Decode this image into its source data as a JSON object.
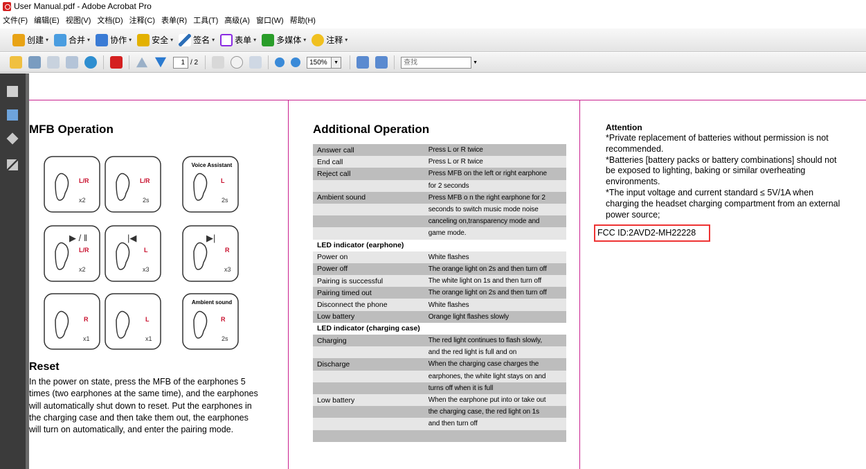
{
  "window": {
    "title": "User Manual.pdf - Adobe Acrobat Pro"
  },
  "menu": [
    "文件(F)",
    "编辑(E)",
    "视图(V)",
    "文档(D)",
    "注释(C)",
    "表单(R)",
    "工具(T)",
    "高级(A)",
    "窗口(W)",
    "帮助(H)"
  ],
  "toolbar1": [
    {
      "label": "创建",
      "icon": "create-icon",
      "color": "#e8a316"
    },
    {
      "label": "合并",
      "icon": "combine-icon",
      "color": "#4a9de0"
    },
    {
      "label": "协作",
      "icon": "collaborate-icon",
      "color": "#3a7bd5"
    },
    {
      "label": "安全",
      "icon": "lock-icon",
      "color": "#e3b100"
    },
    {
      "label": "签名",
      "icon": "pen-icon",
      "color": "#2d6fb8"
    },
    {
      "label": "表单",
      "icon": "form-icon",
      "color": "#8a2be2"
    },
    {
      "label": "多媒体",
      "icon": "multimedia-icon",
      "color": "#2a9d2a"
    },
    {
      "label": "注释",
      "icon": "comment-icon",
      "color": "#f0c020"
    }
  ],
  "toolbar2": {
    "page_current": "1",
    "page_total": "/ 2",
    "zoom": "150%",
    "find_placeholder": "查找"
  },
  "doc": {
    "mfb_heading": "MFB Operation",
    "voice_assistant": "Voice Assistant",
    "ambient_sound": "Ambient sound",
    "reset_heading": "Reset",
    "reset_lines": [
      "In the power on state, press the MFB of the earphones 5",
      "times (two earphones at the same time), and the earphones",
      "will automatically shut down to reset. Put the earphones in",
      "the charging case and then take them out, the earphones",
      "will turn on automatically, and enter the pairing mode."
    ],
    "additional_heading": "Additional Operation",
    "table": [
      {
        "c1": "Answer call",
        "c2": "Press L or R twice",
        "style": "dark"
      },
      {
        "c1": "End call",
        "c2": "Press L or R twice",
        "style": "light"
      },
      {
        "c1": "Reject call",
        "c2": "Press  MFB  on the left or right earphone",
        "style": "dark"
      },
      {
        "c1": "",
        "c2": "for 2 seconds",
        "style": "light"
      },
      {
        "c1": "Ambient sound",
        "c2": "Press MFB o n the right earphone for 2",
        "style": "dark"
      },
      {
        "c1": "",
        "c2": "seconds to switch music mode noise",
        "style": "light"
      },
      {
        "c1": "",
        "c2": "canceling on,transparency mode and",
        "style": "dark"
      },
      {
        "c1": "",
        "c2": "game mode.",
        "style": "light"
      },
      {
        "c1": "LED indicator (earphone)",
        "c2": "",
        "style": "section"
      },
      {
        "c1": "Power on",
        "c2": "White flashes",
        "style": "light"
      },
      {
        "c1": "Power off",
        "c2": "The orange light on 2s and then turn off",
        "style": "dark"
      },
      {
        "c1": "Pairing is successful",
        "c2": "The white light on 1s and then turn off",
        "style": "light"
      },
      {
        "c1": "Pairing timed out",
        "c2": "The orange light on 2s and then turn off",
        "style": "dark"
      },
      {
        "c1": "Disconnect the phone",
        "c2": "White flashes",
        "style": "light"
      },
      {
        "c1": "Low battery",
        "c2": "Orange light flashes slowly",
        "style": "dark"
      },
      {
        "c1": "LED indicator (charging case)",
        "c2": "",
        "style": "section"
      },
      {
        "c1": "Charging",
        "c2": "The red light continues to flash slowly,",
        "style": "dark"
      },
      {
        "c1": "",
        "c2": "and the red light is full and on",
        "style": "light"
      },
      {
        "c1": "Discharge",
        "c2": "When the charging case charges the",
        "style": "dark"
      },
      {
        "c1": "",
        "c2": "earphones, the white light stays on and",
        "style": "light"
      },
      {
        "c1": "",
        "c2": "turns off when it is full",
        "style": "dark"
      },
      {
        "c1": "Low battery",
        "c2": "When the earphone put into or take out",
        "style": "light"
      },
      {
        "c1": "",
        "c2": " the charging case, the red light on 1s",
        "style": "dark"
      },
      {
        "c1": "",
        "c2": "and then turn off",
        "style": "light"
      },
      {
        "c1": "",
        "c2": "",
        "style": "dark"
      }
    ],
    "attention_heading": "Attention",
    "attention_lines": [
      "*Private replacement of batteries without permission is not",
      "recommended.",
      "*Batteries [battery packs or battery combinations] should not",
      "be exposed to lighting, baking or similar overheating",
      "environments.",
      "*The input voltage and current standard ≤ 5V/1A when",
      "charging the headset charging compartment from an external",
      "power source;"
    ],
    "fcc_id": "FCC ID:2AVD2-MH22228",
    "highlight_color": "#e33333",
    "divider_color": "#c9208e"
  }
}
